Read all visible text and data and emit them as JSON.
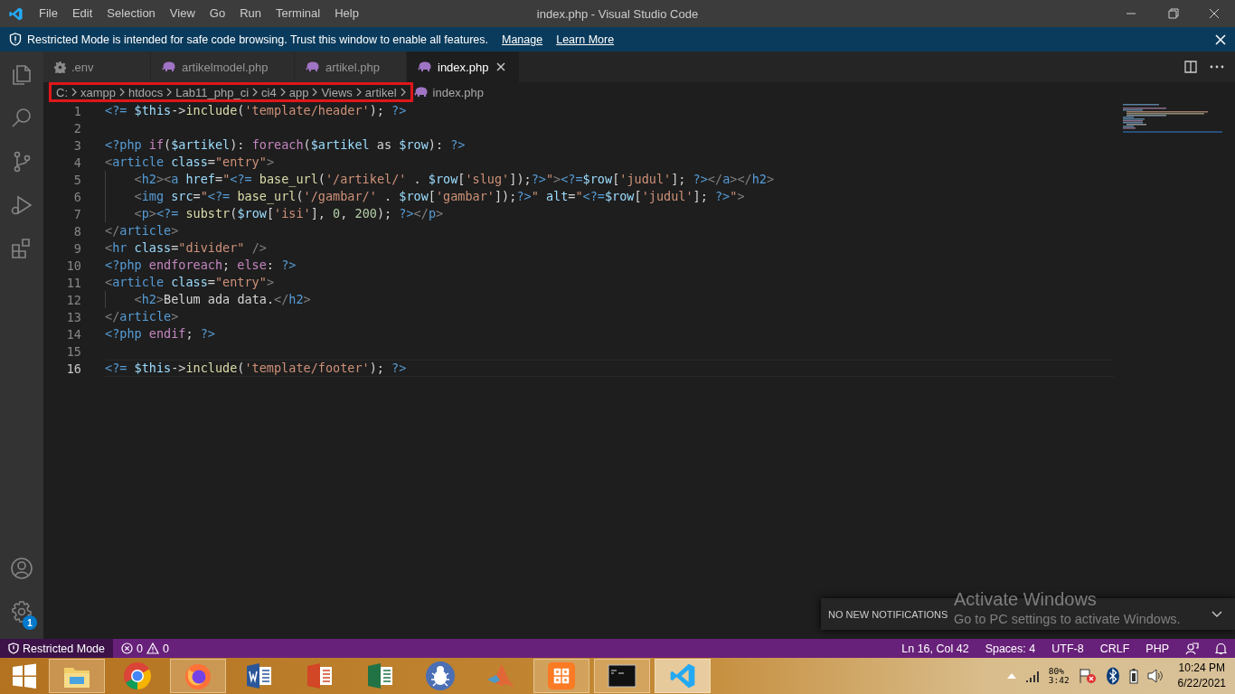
{
  "window": {
    "title": "index.php - Visual Studio Code",
    "menu": [
      "File",
      "Edit",
      "Selection",
      "View",
      "Go",
      "Run",
      "Terminal",
      "Help"
    ]
  },
  "banner": {
    "message": "Restricted Mode is intended for safe code browsing. Trust this window to enable all features.",
    "links": [
      "Manage",
      "Learn More"
    ]
  },
  "activity_bar": {
    "items": [
      {
        "kind": "explorer"
      },
      {
        "kind": "search"
      },
      {
        "kind": "source-control"
      },
      {
        "kind": "debug"
      },
      {
        "kind": "extensions"
      }
    ],
    "settings_badge": "1"
  },
  "tabs": [
    {
      "label": ".env",
      "kind": "gear",
      "selected": false
    },
    {
      "label": "artikelmodel.php",
      "kind": "php",
      "selected": false
    },
    {
      "label": "artikel.php",
      "kind": "php",
      "selected": false
    },
    {
      "label": "index.php",
      "kind": "php",
      "selected": true
    }
  ],
  "breadcrumb": {
    "segments": [
      "C:",
      "xampp",
      "htdocs",
      "Lab11_php_ci",
      "ci4",
      "app",
      "Views",
      "artikel"
    ],
    "file": "index.php",
    "outlined": true
  },
  "editor": {
    "lines": [
      {
        "number": "1",
        "current": false,
        "text": "<?= $this->include('template/header'); ?>"
      },
      {
        "number": "2",
        "current": false
      },
      {
        "number": "3",
        "current": false,
        "text": "<?php if($artikel): foreach($artikel as $row): ?>"
      },
      {
        "number": "4",
        "current": false,
        "text": "<article class=\"entry\">"
      },
      {
        "number": "5",
        "current": false,
        "text": "    <h2><a href=\"<?= base_url('/artikel/' . $row['slug']);?>\"><?=$row['judul']; ?></a></h2>"
      },
      {
        "number": "6",
        "current": false,
        "text": "    <img src=\"<?= base_url('/gambar/' . $row['gambar']);?>\" alt=\"<?=$row['judul']; ?>\">"
      },
      {
        "number": "7",
        "current": false,
        "text": "    <p><?= substr($row['isi'], 0, 200); ?></p>"
      },
      {
        "number": "8",
        "current": false,
        "text": "</article>"
      },
      {
        "number": "9",
        "current": false,
        "text": "<hr class=\"divider\" />"
      },
      {
        "number": "10",
        "current": false,
        "text": "<?php endforeach; else: ?>"
      },
      {
        "number": "11",
        "current": false,
        "text": "<article class=\"entry\">"
      },
      {
        "number": "12",
        "current": false,
        "text": "    <h2>Belum ada data.</h2>"
      },
      {
        "number": "13",
        "current": false,
        "text": "</article>"
      },
      {
        "number": "14",
        "current": false,
        "text": "<?php endif; ?>"
      },
      {
        "number": "15",
        "current": false
      },
      {
        "number": "16",
        "current": true,
        "text": "<?= $this->include('template/footer'); ?>"
      }
    ]
  },
  "notification": {
    "text": "NO NEW NOTIFICATIONS"
  },
  "activation_notice": {
    "title": "Activate Windows",
    "subtitle": "Go to PC settings to activate Windows."
  },
  "status_bar": {
    "restricted": "Restricted Mode",
    "errors": "0",
    "warnings": "0",
    "items": [
      "Ln 16, Col 42",
      "Spaces: 4",
      "UTF-8",
      "CRLF",
      "PHP"
    ]
  },
  "taskbar": {
    "apps": [
      {
        "kind": "files",
        "running": true,
        "selected": false
      },
      {
        "kind": "chrome",
        "running": false,
        "selected": false
      },
      {
        "kind": "firefox",
        "running": true,
        "selected": false
      },
      {
        "kind": "word",
        "running": false,
        "selected": false
      },
      {
        "kind": "powerpoint",
        "running": false,
        "selected": false
      },
      {
        "kind": "excel",
        "running": false,
        "selected": false
      },
      {
        "kind": "bug",
        "running": false,
        "selected": false
      },
      {
        "kind": "matlab",
        "running": false,
        "selected": false
      },
      {
        "kind": "xampp",
        "running": true,
        "selected": false
      },
      {
        "kind": "console",
        "running": true,
        "selected": false
      },
      {
        "kind": "vscode",
        "running": true,
        "selected": true
      }
    ],
    "tray": {
      "battery": "80%",
      "time_left": "3:42",
      "time": "10:24 PM",
      "date": "6/22/2021"
    }
  }
}
